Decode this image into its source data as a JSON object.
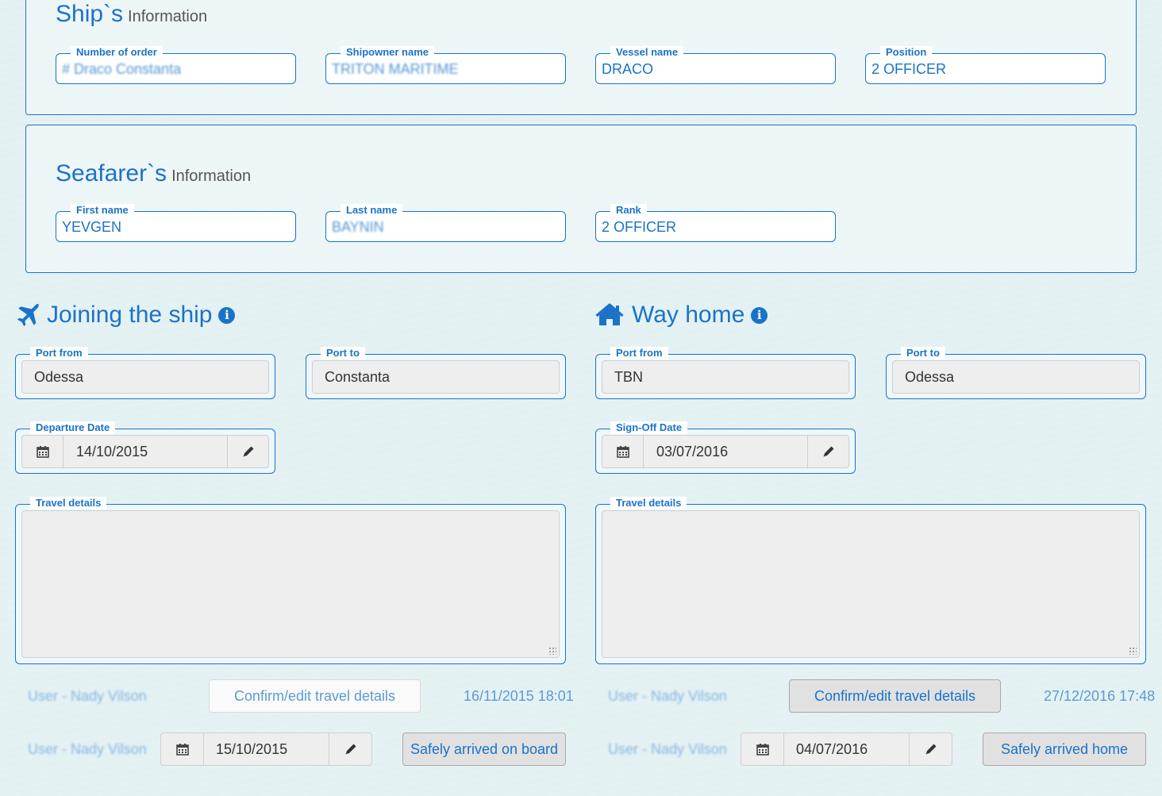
{
  "ship_info": {
    "title": "Ship`s",
    "subtitle": "Information",
    "fields": [
      {
        "label": "Number of order",
        "value": "# Draco Constanta"
      },
      {
        "label": "Shipowner name",
        "value": "TRITON MARITIME"
      },
      {
        "label": "Vessel name",
        "value": "DRACO"
      },
      {
        "label": "Position",
        "value": "2 OFFICER"
      }
    ]
  },
  "seafarer_info": {
    "title": "Seafarer`s",
    "subtitle": "Information",
    "fields": [
      {
        "label": "First name",
        "value": "YEVGEN"
      },
      {
        "label": "Last name",
        "value": "BAYNIN"
      },
      {
        "label": "Rank",
        "value": "2 OFFICER"
      }
    ]
  },
  "joining": {
    "title": "Joining the ship",
    "info_icon": "info-circle-icon",
    "heading_icon": "airplane-icon",
    "port_from_label": "Port from",
    "port_from": "Odessa",
    "port_to_label": "Port to",
    "port_to": "Constanta",
    "date_label": "Departure Date",
    "date": "14/10/2015",
    "travel_label": "Travel details",
    "user": "User - Nady Vilson",
    "confirm_label": "Confirm/edit travel details",
    "confirm_time": "16/11/2015 18:01",
    "arrived_user": "User - Nady Vilson",
    "arrived_date": "15/10/2015",
    "arrived_label": "Safely arrived on board"
  },
  "way_home": {
    "title": "Way home",
    "info_icon": "info-circle-icon",
    "heading_icon": "home-icon",
    "port_from_label": "Port from",
    "port_from": "TBN",
    "port_to_label": "Port to",
    "port_to": "Odessa",
    "date_label": "Sign-Off Date",
    "date": "03/07/2016",
    "travel_label": "Travel details",
    "user": "User - Nady Vilson",
    "confirm_label": "Confirm/edit travel details",
    "confirm_time": "27/12/2016 17:48",
    "arrived_user": "User - Nady Vilson",
    "arrived_date": "04/07/2016",
    "arrived_label": "Safely arrived home"
  },
  "colors": {
    "accent": "#1a73c8",
    "background": "#e3f1f3",
    "muted_text": "#6fa8dc"
  }
}
